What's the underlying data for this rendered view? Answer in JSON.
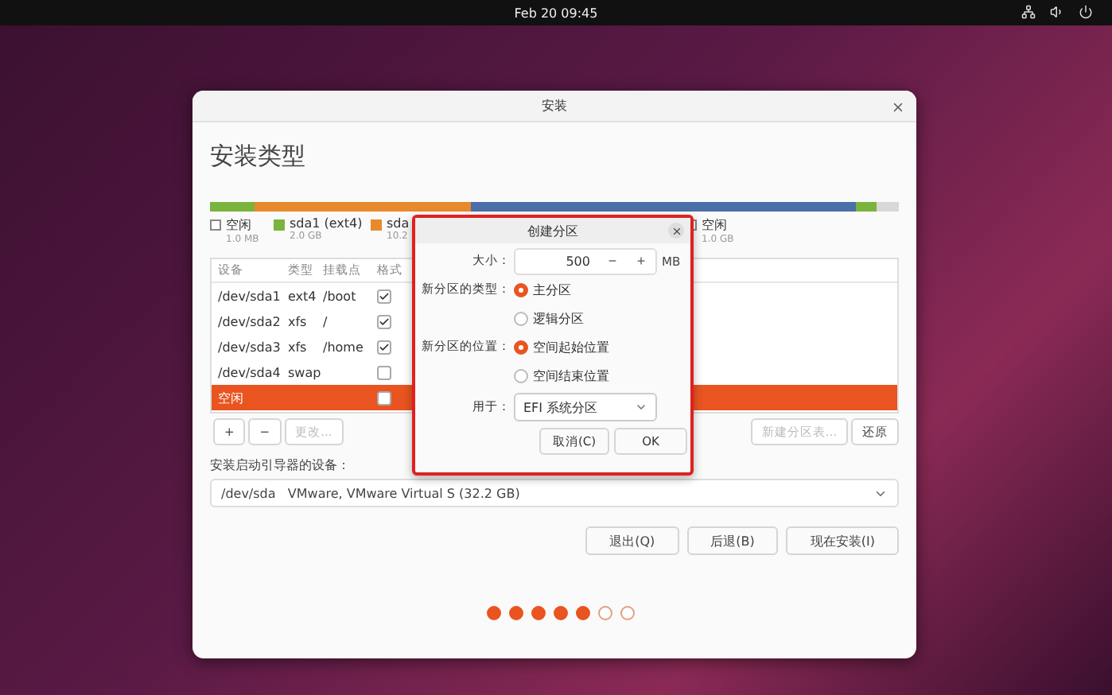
{
  "top_bar": {
    "clock": "Feb 20  09:45"
  },
  "window": {
    "title": "安装",
    "heading": "安装类型"
  },
  "legend": [
    {
      "name": "空闲",
      "size": "1.0 MB"
    },
    {
      "name": "sda1 (ext4)",
      "size": "2.0 GB",
      "color": "#7ab33e"
    },
    {
      "name": "sda",
      "size": "10.2",
      "color": "#e8892c"
    },
    {
      "name": "空闲",
      "size": "1.0 GB"
    }
  ],
  "table": {
    "columns": [
      "设备",
      "类型",
      "挂载点",
      "格式"
    ],
    "rows": [
      {
        "device": "/dev/sda1",
        "type": "ext4",
        "mount": "/boot",
        "format": true,
        "selected": false
      },
      {
        "device": "/dev/sda2",
        "type": "xfs",
        "mount": "/",
        "format": true,
        "selected": false
      },
      {
        "device": "/dev/sda3",
        "type": "xfs",
        "mount": "/home",
        "format": true,
        "selected": false
      },
      {
        "device": "/dev/sda4",
        "type": "swap",
        "mount": "",
        "format": false,
        "selected": false
      },
      {
        "device": "空闲",
        "type": "",
        "mount": "",
        "format": false,
        "selected": true
      }
    ]
  },
  "table_buttons_left": [
    {
      "label": "+",
      "disabled": false
    },
    {
      "label": "−",
      "disabled": false
    },
    {
      "label": "更改...",
      "disabled": true
    }
  ],
  "table_buttons_right": [
    {
      "label": "新建分区表...",
      "disabled": true
    },
    {
      "label": "还原",
      "disabled": false
    }
  ],
  "bootloader": {
    "label": "安装启动引导器的设备：",
    "value": "/dev/sda   VMware, VMware Virtual S (32.2 GB)"
  },
  "actions": [
    "退出(Q)",
    "后退(B)",
    "现在安装(I)"
  ],
  "steps": [
    {
      "done": true
    },
    {
      "done": true
    },
    {
      "done": true
    },
    {
      "done": true
    },
    {
      "done": true
    },
    {
      "done": false
    },
    {
      "done": false
    }
  ],
  "dialog": {
    "title": "创建分区",
    "size_label": "大小：",
    "size_value": "500",
    "minus": "−",
    "plus": "+",
    "unit": "MB",
    "type_label": "新分区的类型：",
    "type_options": [
      {
        "label": "主分区",
        "selected": true
      },
      {
        "label": "逻辑分区",
        "selected": false
      }
    ],
    "location_label": "新分区的位置：",
    "location_options": [
      {
        "label": "空间起始位置",
        "selected": true
      },
      {
        "label": "空间结束位置",
        "selected": false
      }
    ],
    "use_label": "用于：",
    "use_value": "EFI 系统分区",
    "buttons": [
      "取消(C)",
      "OK"
    ]
  }
}
